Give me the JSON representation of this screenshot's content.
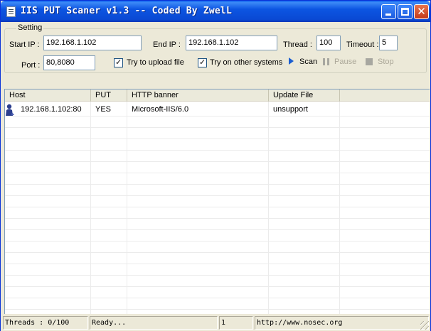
{
  "window": {
    "title": "IIS PUT Scaner v1.3 -- Coded By ZwelL"
  },
  "setting": {
    "group_label": "Setting",
    "start_ip_label": "Start IP :",
    "start_ip_value": "192.168.1.102",
    "end_ip_label": "End IP :",
    "end_ip_value": "192.168.1.102",
    "thread_label": "Thread :",
    "thread_value": "100",
    "timeout_label": "Timeout :",
    "timeout_value": "5",
    "port_label": "Port :",
    "port_value": "80,8080",
    "upload_label": "Try to upload file",
    "upload_checked": true,
    "other_systems_label": "Try on other systems",
    "other_systems_checked": true,
    "scan_label": "Scan",
    "pause_label": "Pause",
    "stop_label": "Stop"
  },
  "results": {
    "columns": [
      "Host",
      "PUT",
      "HTTP banner",
      "Update File"
    ],
    "rows": [
      {
        "host": "192.168.1.102:80",
        "put": "YES",
        "banner": "Microsoft-IIS/6.0",
        "update": "unsupport"
      }
    ]
  },
  "status": {
    "threads": "Threads : 0/100",
    "state": "Ready...",
    "count": "1",
    "url": "http://www.nosec.org"
  },
  "colors": {
    "titlebar": "#0A49D3",
    "face": "#ECE9D8",
    "scan_arrow": "#1B5ED1"
  }
}
